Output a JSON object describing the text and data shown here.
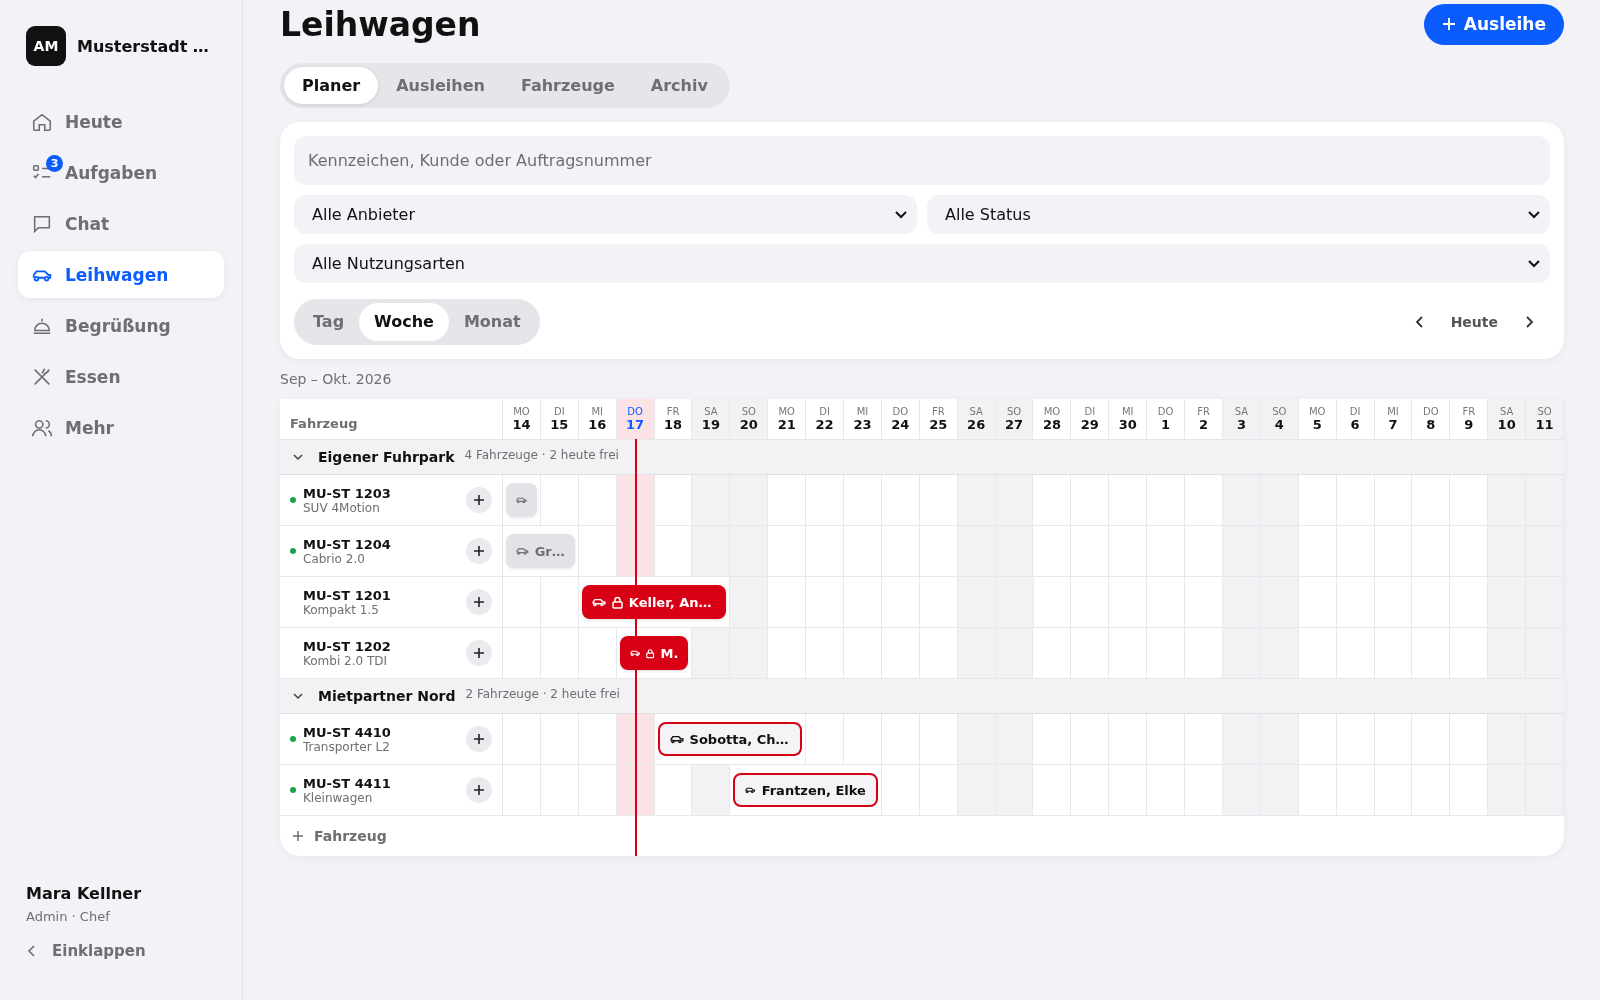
{
  "sidebar": {
    "org": {
      "initials": "AM",
      "name": "Musterstadt …"
    },
    "items": [
      {
        "label": "Heute",
        "selected": false
      },
      {
        "label": "Aufgaben",
        "selected": false,
        "badge": "3"
      },
      {
        "label": "Chat",
        "selected": false
      },
      {
        "label": "Leihwagen",
        "selected": true
      },
      {
        "label": "Begrüßung",
        "selected": false
      },
      {
        "label": "Essen",
        "selected": false
      },
      {
        "label": "Mehr",
        "selected": false
      }
    ],
    "user": {
      "name": "Mara Kellner",
      "role": "Admin · Chef"
    },
    "collapse": "Einklappen"
  },
  "header": {
    "title": "Leihwagen",
    "action": "Ausleihe"
  },
  "tabs": [
    {
      "label": "Planer",
      "selected": true
    },
    {
      "label": "Ausleihen",
      "selected": false
    },
    {
      "label": "Fahrzeuge",
      "selected": false
    },
    {
      "label": "Archiv",
      "selected": false
    }
  ],
  "filters": {
    "search": {
      "placeholder": "Kennzeichen, Kunde oder Auftragsnummer"
    },
    "provider": "Alle Anbieter",
    "status": "Alle Status",
    "usage": "Alle Nutzungsarten",
    "views": [
      {
        "label": "Tag",
        "selected": false
      },
      {
        "label": "Woche",
        "selected": true
      },
      {
        "label": "Monat",
        "selected": false
      }
    ],
    "today": "Heute"
  },
  "range": "Sep – Okt. 2026",
  "planner": {
    "vehicle_header": "Fahrzeug",
    "days": [
      {
        "dow": "MO",
        "day": "14",
        "weekend": false,
        "today": false
      },
      {
        "dow": "DI",
        "day": "15",
        "weekend": false,
        "today": false
      },
      {
        "dow": "MI",
        "day": "16",
        "weekend": false,
        "today": false
      },
      {
        "dow": "DO",
        "day": "17",
        "weekend": false,
        "today": true
      },
      {
        "dow": "FR",
        "day": "18",
        "weekend": false,
        "today": false
      },
      {
        "dow": "SA",
        "day": "19",
        "weekend": true,
        "today": false
      },
      {
        "dow": "SO",
        "day": "20",
        "weekend": true,
        "today": false
      },
      {
        "dow": "MO",
        "day": "21",
        "weekend": false,
        "today": false
      },
      {
        "dow": "DI",
        "day": "22",
        "weekend": false,
        "today": false
      },
      {
        "dow": "MI",
        "day": "23",
        "weekend": false,
        "today": false
      },
      {
        "dow": "DO",
        "day": "24",
        "weekend": false,
        "today": false
      },
      {
        "dow": "FR",
        "day": "25",
        "weekend": false,
        "today": false
      },
      {
        "dow": "SA",
        "day": "26",
        "weekend": true,
        "today": false
      },
      {
        "dow": "SO",
        "day": "27",
        "weekend": true,
        "today": false
      },
      {
        "dow": "MO",
        "day": "28",
        "weekend": false,
        "today": false
      },
      {
        "dow": "DI",
        "day": "29",
        "weekend": false,
        "today": false
      },
      {
        "dow": "MI",
        "day": "30",
        "weekend": false,
        "today": false
      },
      {
        "dow": "DO",
        "day": "1",
        "weekend": false,
        "today": false
      },
      {
        "dow": "FR",
        "day": "2",
        "weekend": false,
        "today": false
      },
      {
        "dow": "SA",
        "day": "3",
        "weekend": true,
        "today": false
      },
      {
        "dow": "SO",
        "day": "4",
        "weekend": true,
        "today": false
      },
      {
        "dow": "MO",
        "day": "5",
        "weekend": false,
        "today": false
      },
      {
        "dow": "DI",
        "day": "6",
        "weekend": false,
        "today": false
      },
      {
        "dow": "MI",
        "day": "7",
        "weekend": false,
        "today": false
      },
      {
        "dow": "DO",
        "day": "8",
        "weekend": false,
        "today": false
      },
      {
        "dow": "FR",
        "day": "9",
        "weekend": false,
        "today": false
      },
      {
        "dow": "SA",
        "day": "10",
        "weekend": true,
        "today": false
      },
      {
        "dow": "SO",
        "day": "11",
        "weekend": true,
        "today": false
      }
    ],
    "groups": [
      {
        "name": "Eigener Fuhrpark",
        "meta": "4 Fahrzeuge · 2 heute frei",
        "expanded": true,
        "vehicles": [
          {
            "plate": "MU-ST 1203",
            "model": "SUV 4Motion",
            "available": true,
            "bookings": [
              {
                "kind": "reserved",
                "locked": false,
                "covers": [
                  true
                ]
              }
            ]
          },
          {
            "plate": "MU-ST 1204",
            "model": "Cabrio 2.0",
            "available": true,
            "bookings": [
              {
                "kind": "reserved",
                "locked": false,
                "covers": [
                  true,
                  true
                ],
                "label": "Gr…"
              }
            ]
          },
          {
            "plate": "MU-ST 1201",
            "model": "Kompakt 1.5",
            "available": false,
            "bookings": [
              {
                "kind": "active",
                "locked": true,
                "covers": [
                  false,
                  false,
                  true,
                  true,
                  true,
                  true
                ],
                "label": "Keller, An…"
              }
            ]
          },
          {
            "plate": "MU-ST 1202",
            "model": "Kombi 2.0 TDI",
            "available": false,
            "bookings": [
              {
                "kind": "active",
                "locked": true,
                "covers": [
                  false,
                  false,
                  false,
                  true,
                  true
                ],
                "label": "M."
              }
            ]
          }
        ]
      },
      {
        "name": "Mietpartner Nord",
        "meta": "2 Fahrzeuge · 2 heute frei",
        "expanded": true,
        "vehicles": [
          {
            "plate": "MU-ST 4410",
            "model": "Transporter L2",
            "available": true,
            "bookings": [
              {
                "kind": "planned",
                "locked": false,
                "covers": [
                  false,
                  false,
                  false,
                  false,
                  true,
                  true,
                  true,
                  true
                ],
                "label": "Sobotta, Ch…"
              }
            ]
          },
          {
            "plate": "MU-ST 4411",
            "model": "Kleinwagen",
            "available": true,
            "bookings": [
              {
                "kind": "planned",
                "locked": false,
                "covers": [
                  false,
                  false,
                  false,
                  false,
                  false,
                  false,
                  true,
                  true,
                  true,
                  true
                ],
                "label": "Frantzen, Elke"
              }
            ]
          }
        ]
      }
    ],
    "add_vehicle": "Fahrzeug"
  }
}
